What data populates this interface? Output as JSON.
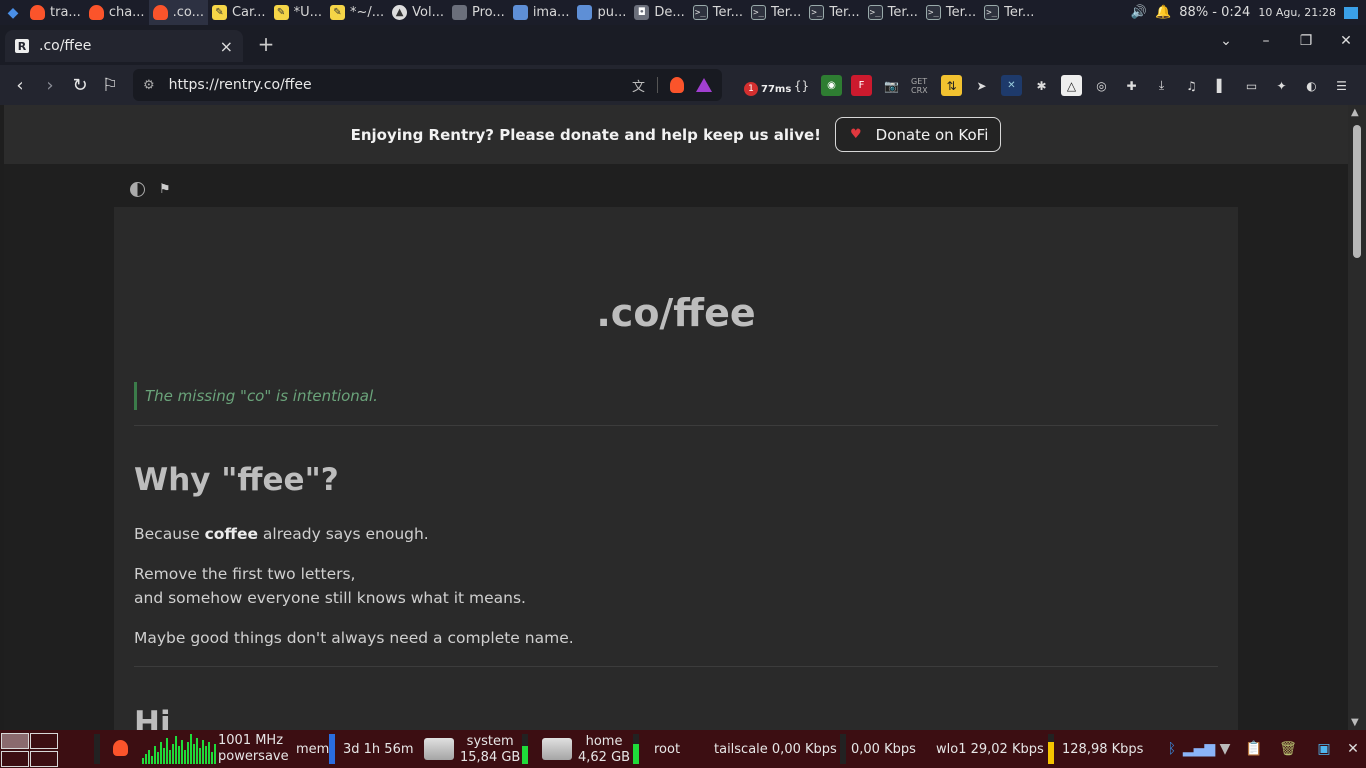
{
  "desktop_taskbar": {
    "tasks": [
      {
        "label": "tra...",
        "icon": "brave-icon"
      },
      {
        "label": "cha...",
        "icon": "brave-icon"
      },
      {
        "label": ".co...",
        "icon": "brave-icon"
      },
      {
        "label": "Car...",
        "icon": "text-editor-icon"
      },
      {
        "label": "*U...",
        "icon": "text-editor-icon"
      },
      {
        "label": "*~/...",
        "icon": "text-editor-icon"
      },
      {
        "label": "Vol...",
        "icon": "vlc-icon"
      },
      {
        "label": "Pro...",
        "icon": "window-icon"
      },
      {
        "label": "ima...",
        "icon": "folder-icon"
      },
      {
        "label": "pu...",
        "icon": "folder-icon"
      },
      {
        "label": "De...",
        "icon": "screen-icon"
      },
      {
        "label": "Ter...",
        "icon": "terminal-icon"
      },
      {
        "label": "Ter...",
        "icon": "terminal-icon"
      },
      {
        "label": "Ter...",
        "icon": "terminal-icon"
      },
      {
        "label": "Ter...",
        "icon": "terminal-icon"
      },
      {
        "label": "Ter...",
        "icon": "terminal-icon"
      },
      {
        "label": "Ter...",
        "icon": "terminal-icon"
      }
    ],
    "battery": "88% - 0:24",
    "clock": "10 Agu, 21:28"
  },
  "browser": {
    "tab_title": ".co/ffee",
    "tab_favicon": "R",
    "url": "https://rentry.co/ffee",
    "ext_badge": "1",
    "ext_ping": "77ms",
    "ext_get_crx": "GET CRX"
  },
  "page": {
    "banner_text": "Enjoying Rentry? Please donate and help keep us alive!",
    "donate_label": "Donate on KoFi",
    "title": ".co/ffee",
    "quote": "The missing \"co\" is intentional.",
    "heading_why": "Why \"ffee\"?",
    "p1_before": "Because ",
    "p1_bold": "coffee",
    "p1_after": " already says enough.",
    "p2_line1": "Remove the first two letters,",
    "p2_line2": "and somehow everyone still knows what it means.",
    "p3": "Maybe good things don't always need a complete name.",
    "heading_hi": "Hi"
  },
  "bottom_panel": {
    "cpu_freq": "1001 MHz",
    "cpu_governor": "powersave",
    "mem_label": "mem",
    "uptime": "3d 1h 56m",
    "system_label": "system",
    "system_free": "15,84 GB",
    "home_label": "home",
    "home_free": "4,62 GB",
    "root_label": "root",
    "tailscale": "tailscale 0,00 Kbps",
    "tailscale_2": "0,00 Kbps",
    "wlo1": "wlo1 29,02 Kbps",
    "wlo1_2": "128,98 Kbps"
  },
  "colors": {
    "accent_brave": "#fb542b",
    "quote_green": "#3b7c4a",
    "panel_bg": "#3c0e12"
  }
}
